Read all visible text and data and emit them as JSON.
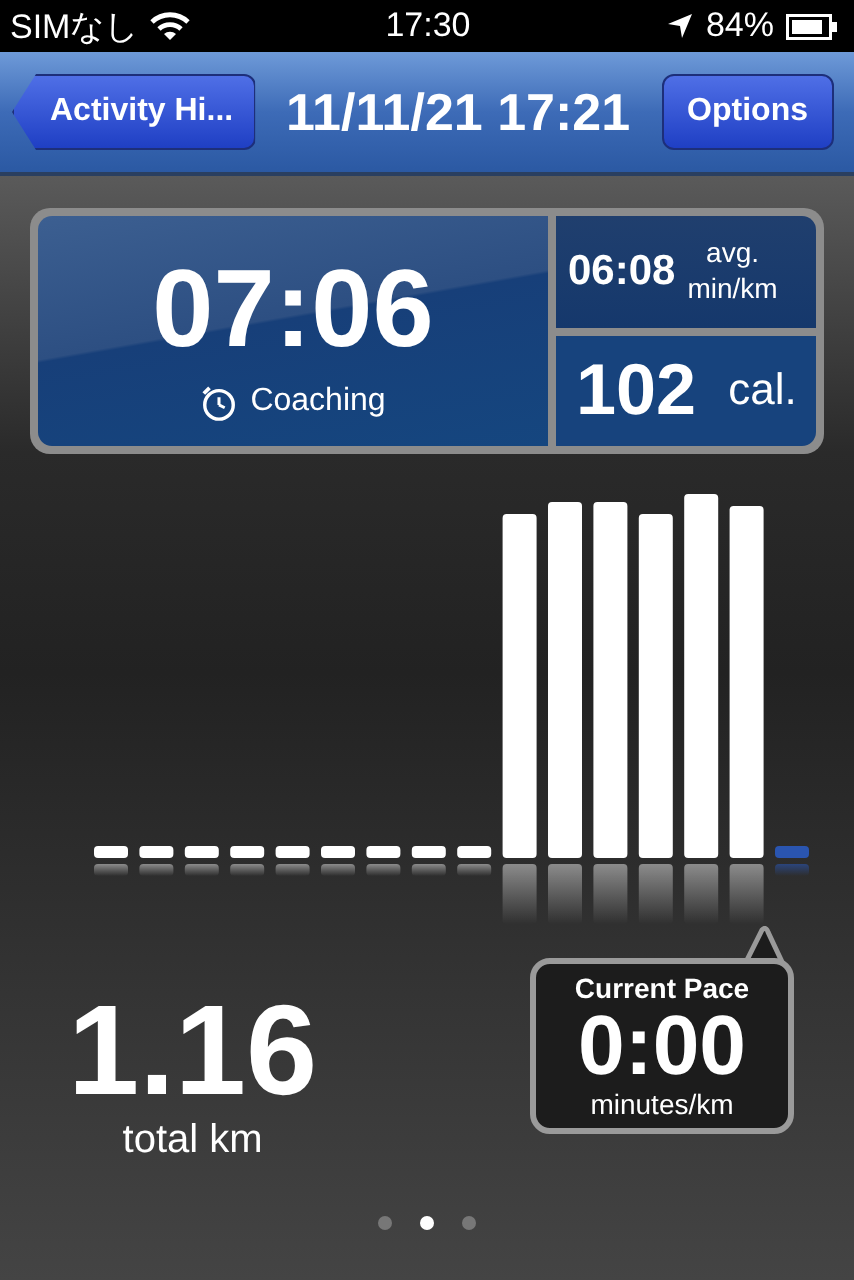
{
  "status_bar": {
    "carrier": "SIMなし",
    "time": "17:30",
    "battery": "84%"
  },
  "nav_bar": {
    "back_button": "Activity Hi...",
    "title": "11/11/21 17:21",
    "right_button": "Options"
  },
  "summary": {
    "duration": "07:06",
    "mode": "Coaching",
    "avg_pace": "06:08",
    "avg_unit_top": "avg.",
    "avg_unit_bottom": "min/km",
    "calories": "102",
    "calories_unit": "cal."
  },
  "distance": {
    "value": "1.16",
    "unit": "total km"
  },
  "current_pace": {
    "label": "Current Pace",
    "value": "0:00",
    "unit": "minutes/km"
  },
  "page_indicator": [
    {
      "selected": false
    },
    {
      "selected": true
    },
    {
      "selected": false
    }
  ]
}
